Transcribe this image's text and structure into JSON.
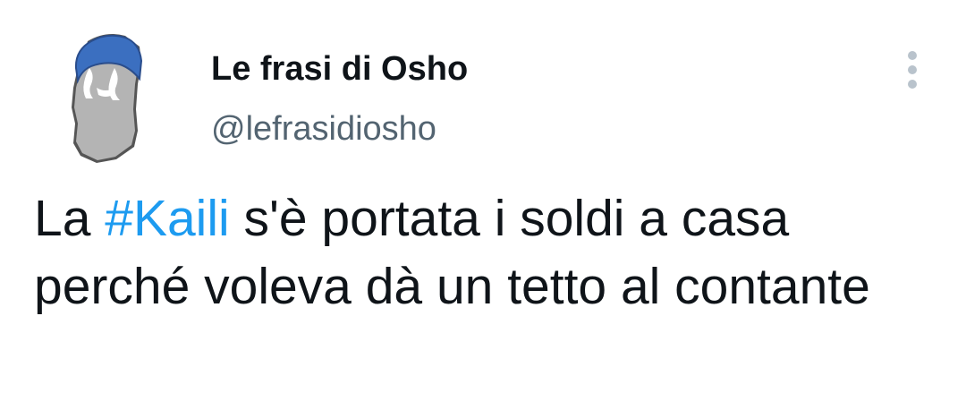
{
  "tweet": {
    "author": {
      "display_name": "Le frasi di Osho",
      "handle": "@lefrasidiosho",
      "avatar_icon": "bearded-man-icon"
    },
    "menu_icon": "more-vertical-icon",
    "text": {
      "before": "La ",
      "hashtag": "#Kaili",
      "after": " s'è portata i soldi a casa perché voleva dà un tetto al contante"
    }
  },
  "colors": {
    "text": "#0f1419",
    "handle": "#536471",
    "hashtag": "#1d9bf0",
    "avatar_cap": "#3b6fc0",
    "avatar_beard": "#b4b4b4"
  }
}
